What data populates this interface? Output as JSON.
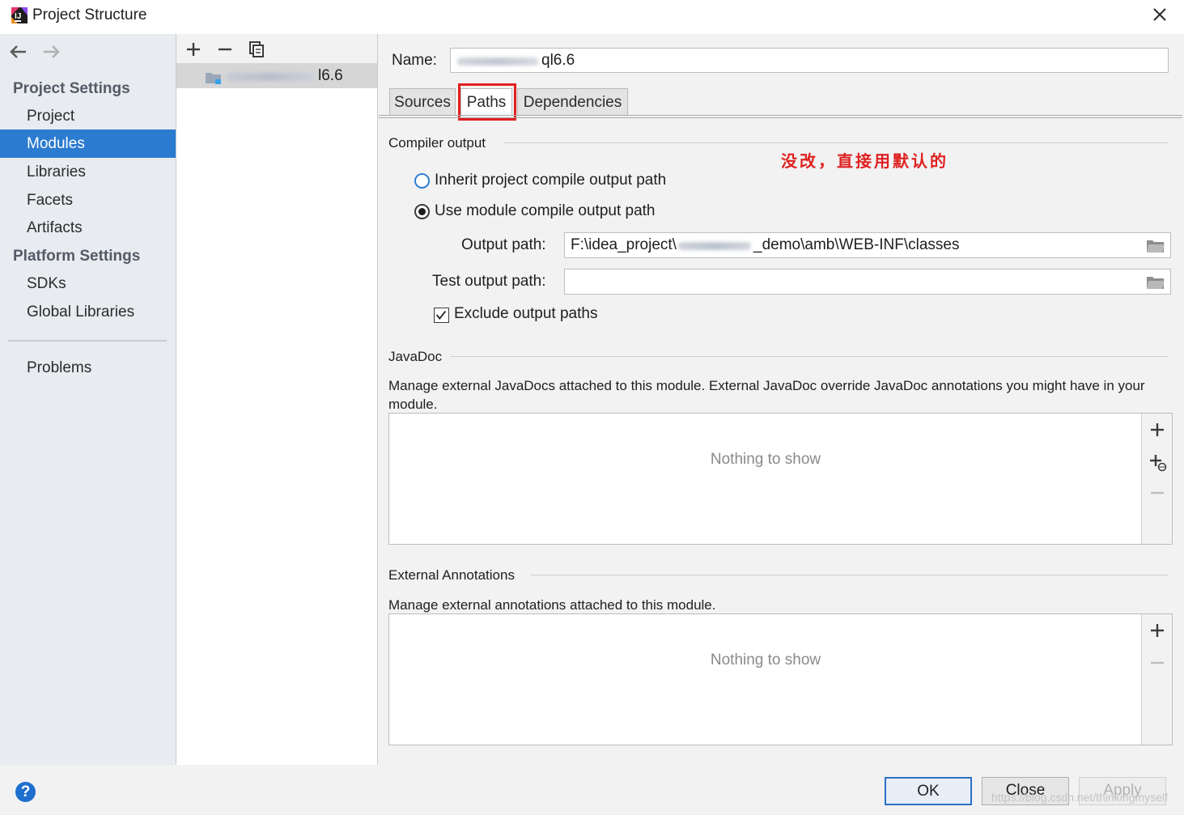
{
  "window": {
    "title": "Project Structure"
  },
  "nav": {
    "project_settings_heading": "Project Settings",
    "platform_settings_heading": "Platform Settings",
    "items": [
      {
        "label": "Project",
        "selected": false
      },
      {
        "label": "Modules",
        "selected": true
      },
      {
        "label": "Libraries",
        "selected": false
      },
      {
        "label": "Facets",
        "selected": false
      },
      {
        "label": "Artifacts",
        "selected": false
      },
      {
        "label": "SDKs",
        "selected": false
      },
      {
        "label": "Global Libraries",
        "selected": false
      },
      {
        "label": "Problems",
        "selected": false
      }
    ],
    "accent_color": "#2b7bd0"
  },
  "modules": {
    "selected_module_suffix": "l6.6"
  },
  "module": {
    "name_label": "Name:",
    "name_value_suffix": "ql6.6",
    "tabs": [
      {
        "label": "Sources",
        "active": false
      },
      {
        "label": "Paths",
        "active": true
      },
      {
        "label": "Dependencies",
        "active": false
      }
    ],
    "compiler_output": {
      "title": "Compiler output",
      "annotation": "没改，直接用默认的",
      "radio_inherit": "Inherit project compile output path",
      "radio_module": "Use module compile output path",
      "selected_option": "Use module compile output path",
      "output_path_label": "Output path:",
      "output_path_prefix": "F:\\idea_project\\",
      "output_path_suffix": "_demo\\amb\\WEB-INF\\classes",
      "test_output_path_label": "Test output path:",
      "test_output_path_value": "",
      "exclude_label": "Exclude output paths",
      "exclude_checked": true
    },
    "javadoc": {
      "title": "JavaDoc",
      "description": "Manage external JavaDocs attached to this module. External JavaDoc override JavaDoc annotations you might have in your module.",
      "empty_text": "Nothing to show"
    },
    "external_annotations": {
      "title": "External Annotations",
      "description": "Manage external annotations attached to this module.",
      "empty_text": "Nothing to show"
    }
  },
  "footer": {
    "ok_label": "OK",
    "close_label": "Close",
    "apply_label": "Apply",
    "help_label": "?",
    "watermark": "https://blog.csdn.net/thinkingmyself"
  },
  "colors": {
    "highlight_red": "#e02020",
    "primary_blue": "#2b6fc7"
  }
}
